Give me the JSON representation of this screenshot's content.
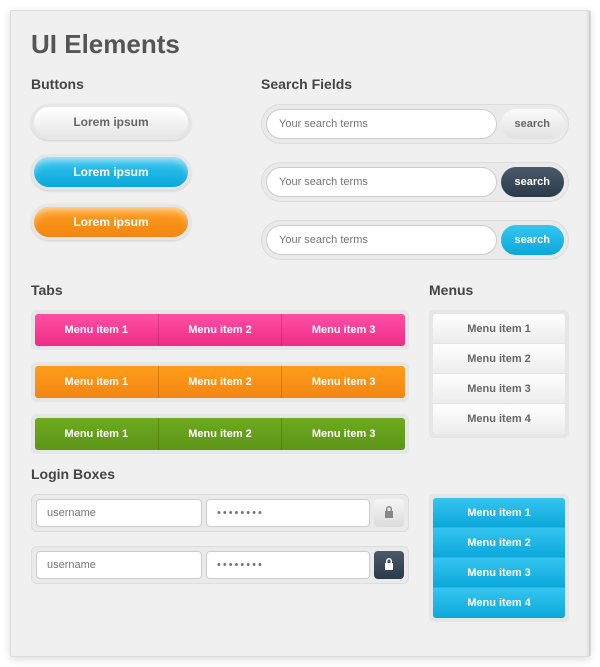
{
  "title": "UI Elements",
  "sections": {
    "buttons": "Buttons",
    "search": "Search Fields",
    "tabs": "Tabs",
    "menus": "Menus",
    "login": "Login Boxes"
  },
  "buttons": {
    "b1": "Lorem ipsum",
    "b2": "Lorem ipsum",
    "b3": "Lorem ipsum"
  },
  "search": {
    "placeholder": "Your search terms",
    "button": "search"
  },
  "tabs": {
    "t1": "Menu item 1",
    "t2": "Menu item 2",
    "t3": "Menu item 3"
  },
  "menu1": {
    "i1": "Menu item 1",
    "i2": "Menu item 2",
    "i3": "Menu item 3",
    "i4": "Menu item 4"
  },
  "menu2": {
    "i1": "Menu item 1",
    "i2": "Menu item 2",
    "i3": "Menu item 3",
    "i4": "Menu item 4"
  },
  "login": {
    "username": "username",
    "password_mask": "••••••••"
  },
  "colors": {
    "blue": "#1eb4e6",
    "orange": "#f78f1e",
    "pink": "#f23a93",
    "green": "#62a01a",
    "dark": "#384b5c"
  }
}
